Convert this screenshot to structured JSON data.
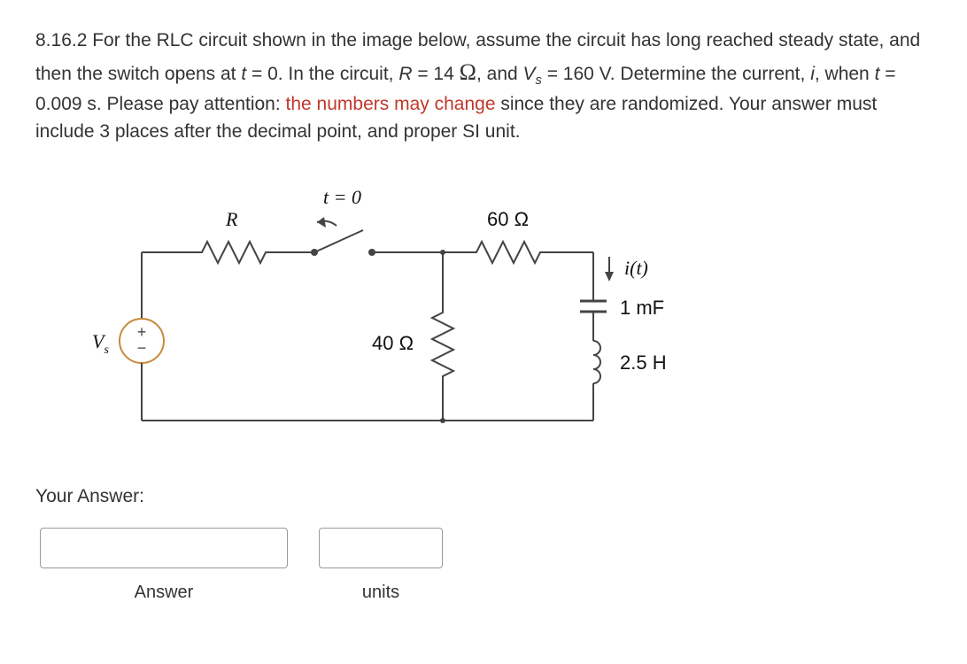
{
  "problem": {
    "number": "8.16.2",
    "text_parts": {
      "p1": "8.16.2 For the RLC circuit shown in the image below, assume the circuit has long reached steady state, and then the switch opens at ",
      "t_zero": "t",
      "p2": " = 0. In the circuit, ",
      "R_var": "R",
      "p3": " = 14 ",
      "omega1": "Ω",
      "p4": ", and ",
      "Vs_var": "V",
      "Vs_sub": "s",
      "p5": " = 160 V. Determine the current, ",
      "i_var": "i",
      "p6": ", when ",
      "t_var2": "t",
      "p7": " = 0.009 s. Please pay attention: ",
      "red1": "the numbers may change",
      "p8": " since they are randomized. Your answer must include 3 places after the decimal point, and proper SI unit."
    }
  },
  "circuit": {
    "t_label": "t = 0",
    "R_label": "R",
    "r60_label": "60 Ω",
    "r40_label": "40 Ω",
    "it_label": "i(t)",
    "cap_label": "1 mF",
    "ind_label": "2.5 H",
    "vs_label": "V",
    "vs_sub": "s"
  },
  "answer_section": {
    "your_answer_label": "Your Answer:",
    "answer_label": "Answer",
    "units_label": "units"
  }
}
